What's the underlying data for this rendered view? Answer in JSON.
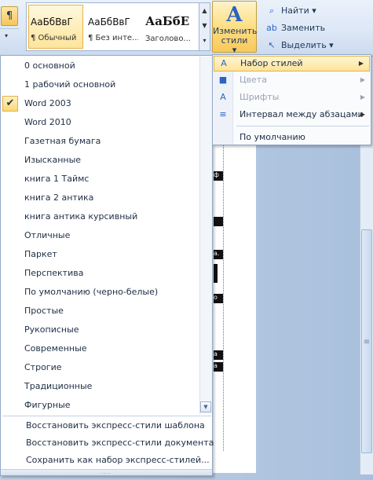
{
  "ribbon": {
    "pilcrow": "¶",
    "gallery": [
      {
        "sample": "АаБбВвГ",
        "name": "¶ Обычный",
        "active": true
      },
      {
        "sample": "АаБбВвГ",
        "name": "¶ Без инте...",
        "active": false
      },
      {
        "sample": "АаБбЕ",
        "name": "Заголово...",
        "active": false
      }
    ],
    "change_styles": {
      "icon": "A",
      "line1": "Изменить",
      "line2": "стили"
    },
    "editing": [
      {
        "icon": "binoculars-icon",
        "glyph": "⌕",
        "label": "Найти ▾"
      },
      {
        "icon": "replace-icon",
        "glyph": "ab",
        "label": "Заменить"
      },
      {
        "icon": "select-cursor-icon",
        "glyph": "↖",
        "label": "Выделить ▾"
      }
    ]
  },
  "style_sets": [
    {
      "label": "0 основной",
      "checked": false
    },
    {
      "label": "1 рабочий основной",
      "checked": false
    },
    {
      "label": "Word 2003",
      "checked": true
    },
    {
      "label": "Word 2010",
      "checked": false
    },
    {
      "label": "Газетная бумага",
      "checked": false
    },
    {
      "label": "Изысканные",
      "checked": false
    },
    {
      "label": "книга 1 Таймс",
      "checked": false
    },
    {
      "label": "книга 2 антикa",
      "checked": false
    },
    {
      "label": "книга антикa курсивный",
      "checked": false
    },
    {
      "label": "Отличные",
      "checked": false
    },
    {
      "label": "Паркет",
      "checked": false
    },
    {
      "label": "Перспектива",
      "checked": false
    },
    {
      "label": "По умолчанию (черно-белые)",
      "checked": false
    },
    {
      "label": "Простые",
      "checked": false
    },
    {
      "label": "Рукописные",
      "checked": false
    },
    {
      "label": "Современные",
      "checked": false
    },
    {
      "label": "Строгие",
      "checked": false
    },
    {
      "label": "Традиционные",
      "checked": false
    },
    {
      "label": "Фигурные",
      "checked": false
    }
  ],
  "style_actions": [
    "Восстановить экспресс-стили шаблона",
    "Восстановить экспресс-стили документа",
    "Сохранить как набор экспресс-стилей..."
  ],
  "change_menu": [
    {
      "label": "Набор стилей",
      "state": "hot",
      "icon": "style-set-icon",
      "glyph": "A",
      "arrow": true
    },
    {
      "label": "Цвета",
      "state": "disabled",
      "icon": "colors-icon",
      "glyph": "■",
      "arrow": true
    },
    {
      "label": "Шрифты",
      "state": "disabled",
      "icon": "fonts-icon",
      "glyph": "A",
      "arrow": true
    },
    {
      "label": "Интервал между абзацами",
      "state": "normal",
      "icon": "paragraph-spacing-icon",
      "glyph": "≡",
      "arrow": true
    },
    {
      "label": "По умолчанию",
      "state": "normal",
      "icon": "",
      "glyph": "",
      "arrow": false
    }
  ],
  "document_fragments": [
    "ф",
    "",
    "а.",
    "",
    "о",
    "а",
    "а"
  ],
  "symbols": {
    "check": "✔",
    "submenu_arrow": "▶",
    "dropdown": "▾",
    "scroll_up": "▲",
    "scroll_down": "▼",
    "grip": "....",
    "thumb_grip": "≡"
  }
}
